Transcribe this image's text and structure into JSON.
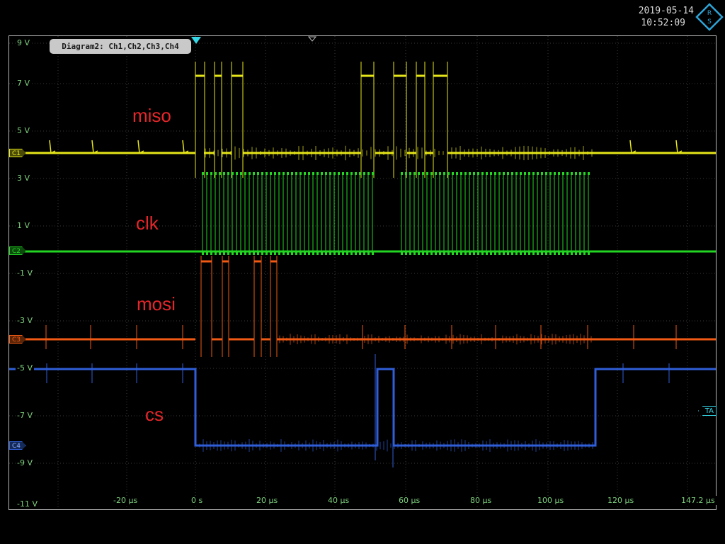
{
  "header": {
    "date": "2019-05-14",
    "time": "10:52:09",
    "logo_icon": "rohde-schwarz-logo-icon"
  },
  "diagram_tab": {
    "label": "Diagram2: Ch1,Ch2,Ch3,Ch4"
  },
  "voltage_labels": [
    "9 V",
    "7 V",
    "5 V",
    "3 V",
    "1 V",
    "-1 V",
    "-3 V",
    "-5 V",
    "-7 V",
    "-9 V",
    "-11 V"
  ],
  "time_labels": [
    "-20 µs",
    "0 s",
    "20 µs",
    "40 µs",
    "60 µs",
    "80 µs",
    "100 µs",
    "120 µs",
    "147.2 µs"
  ],
  "channel_names": {
    "miso": "miso",
    "clk": "clk",
    "mosi": "mosi",
    "cs": "cs"
  },
  "markers": {
    "c1": "C1",
    "c2": "C2",
    "c3": "C3",
    "c4": "C4",
    "ta": "TA"
  },
  "colors": {
    "c1": "#e6e61a",
    "c2": "#22d622",
    "c3": "#f05a14",
    "c4": "#2f5ed8",
    "grid": "#3a3a3a",
    "label": "#7fd27f",
    "annotation": "#e6262a",
    "trigger": "#35d6e6"
  }
}
